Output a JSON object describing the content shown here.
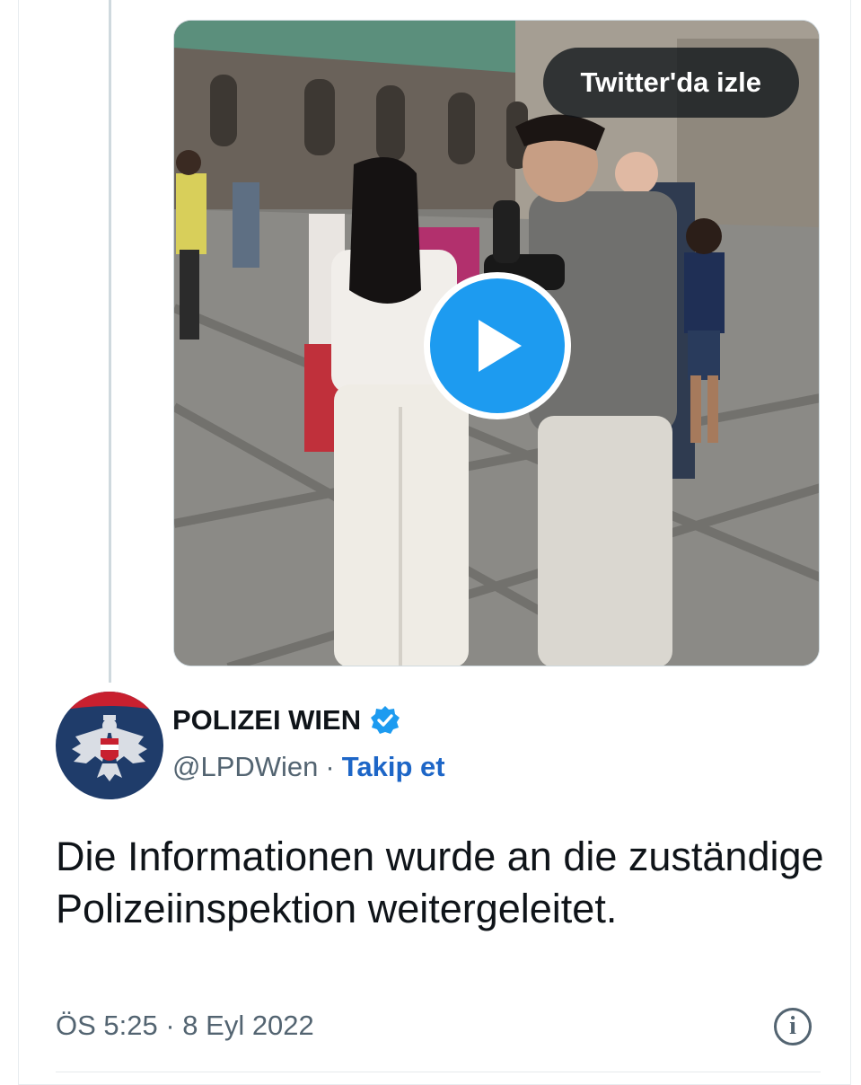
{
  "media": {
    "watch_label": "Twitter'da izle",
    "play_icon": "play-icon",
    "accent_color": "#1d9bf0"
  },
  "author": {
    "display_name": "POLIZEI WIEN",
    "verified_icon": "verified-badge-icon",
    "handle": "@LPDWien",
    "separator": "·",
    "follow_label": "Takip et",
    "avatar_icon": "austrian-eagle-logo"
  },
  "tweet": {
    "text": "Die Informationen wurde an die zuständige Polizeiinspektion weitergeleitet.",
    "timestamp": "ÖS 5:25 · 8 Eyl 2022",
    "info_icon": "info-icon",
    "info_glyph": "i"
  }
}
